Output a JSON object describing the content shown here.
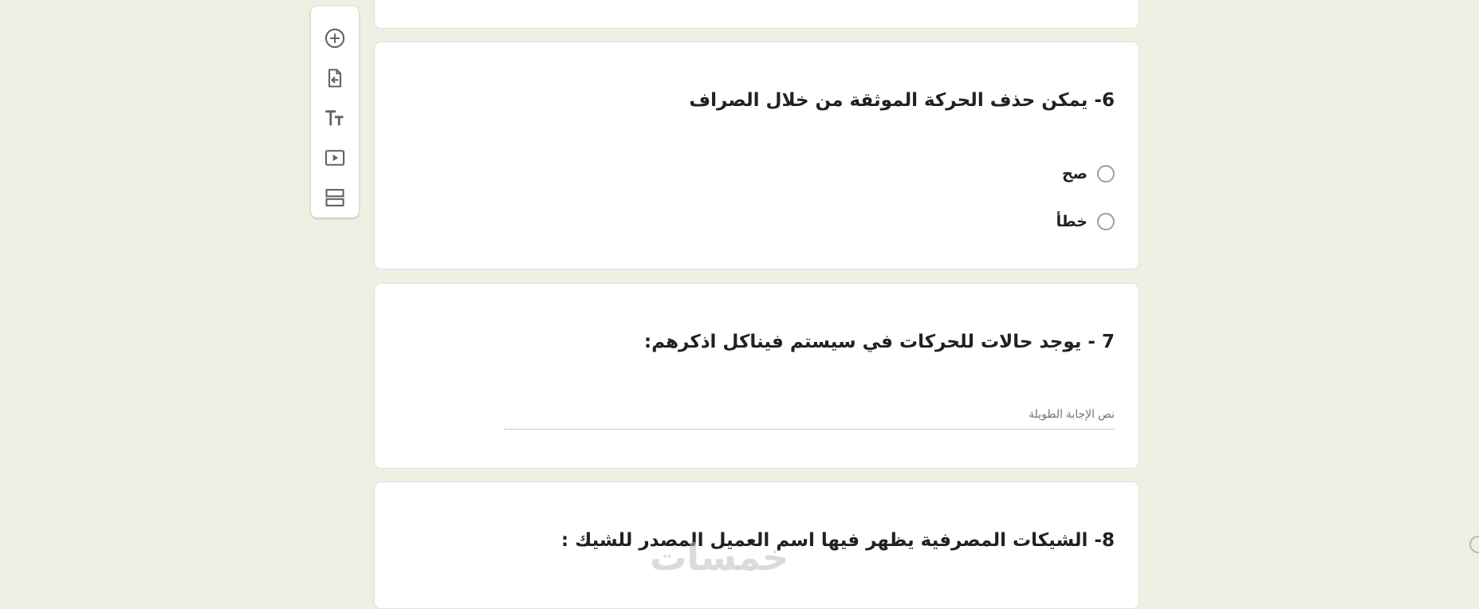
{
  "toolbar": {
    "items": [
      {
        "icon": "add-circle-icon"
      },
      {
        "icon": "import-questions-icon"
      },
      {
        "icon": "title-text-icon"
      },
      {
        "icon": "video-icon"
      },
      {
        "icon": "section-icon"
      }
    ]
  },
  "questions": [
    {
      "title": "6- يمكن حذف الحركة الموثقة من خلال الصراف",
      "options": [
        "صح",
        "خطأ"
      ]
    },
    {
      "title": "7 - يوجد حالات للحركات في سيستم فيناكل اذكرهم:",
      "placeholder": "نص الإجابة الطويلة"
    },
    {
      "title": "8- الشيكات المصرفية يظهر فيها اسم العميل المصدر للشيك :"
    }
  ],
  "watermark": "خمسات"
}
